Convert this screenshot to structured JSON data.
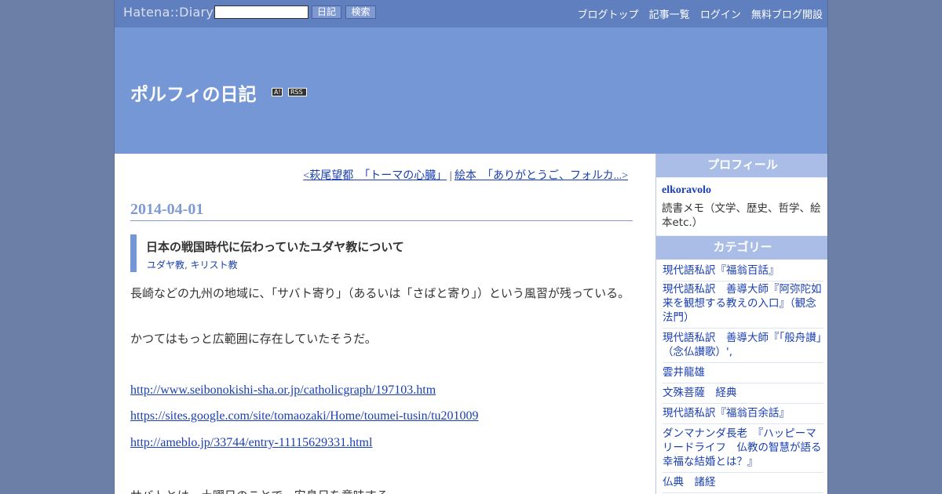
{
  "topbar": {
    "logo": "Hatena::Diary",
    "search_placeholder": "",
    "diary_button": "日記",
    "search_button": "検索",
    "nav": [
      "ブログトップ",
      "記事一覧",
      "ログイン",
      "無料ブログ開設"
    ]
  },
  "header": {
    "title": "ポルフィの日記",
    "badge_a": "A!",
    "badge_rss": "RSS"
  },
  "pager": {
    "prev": "<萩尾望都　「トーマの心臓」",
    "separator": "|",
    "next": "絵本　「ありがとうご、フォルカ...>"
  },
  "entry": {
    "date": "2014-04-01",
    "title": "日本の戦国時代に伝わっていたユダヤ教について",
    "categories": [
      "ユダヤ教",
      "キリスト教"
    ],
    "category_sep": ",",
    "paragraphs": [
      "長崎などの九州の地域に、「サバト寄り」（あるいは「さばと寄り」）という風習が残っている。",
      "かつてはもっと広範囲に存在していたそうだ。"
    ],
    "links": [
      "http://www.seibonokishi-sha.or.jp/catholicgraph/197103.htm",
      "https://sites.google.com/site/tomaozaki/Home/toumei-tusin/tu201009",
      "http://ameblo.jp/33744/entry-11115629331.html"
    ],
    "trailing_text": "サバトとは、土曜日のことで、安息日を意味する。"
  },
  "sidebar": {
    "profile_heading": "プロフィール",
    "profile_name": "elkoravolo",
    "profile_desc": "読書メモ（文学、歴史、哲学、絵本etc.）",
    "category_heading": "カテゴリー",
    "categories": [
      "現代語私訳『福翁百話』",
      "現代語私訳　善導大師『阿弥陀如来を観想する教えの入口』（観念法門）",
      "現代語私訳　善導大師『「般舟讃」（念仏讃歌）',",
      "雲井龍雄",
      "文殊菩薩　経典",
      "現代語私訳『福翁百余話』",
      "ダンマナンダ長老　『ハッピーマリードライフ　仏教の智慧が語る幸福な結婚とは？』",
      "仏典　諸経"
    ]
  },
  "colors": {
    "topbar": "#5f7fbe",
    "header": "#7597d6",
    "accent": "#7f9bd0",
    "link": "#1a3fb0",
    "side_heading": "#a9bde6",
    "page_bg": "#6b7fa7"
  }
}
